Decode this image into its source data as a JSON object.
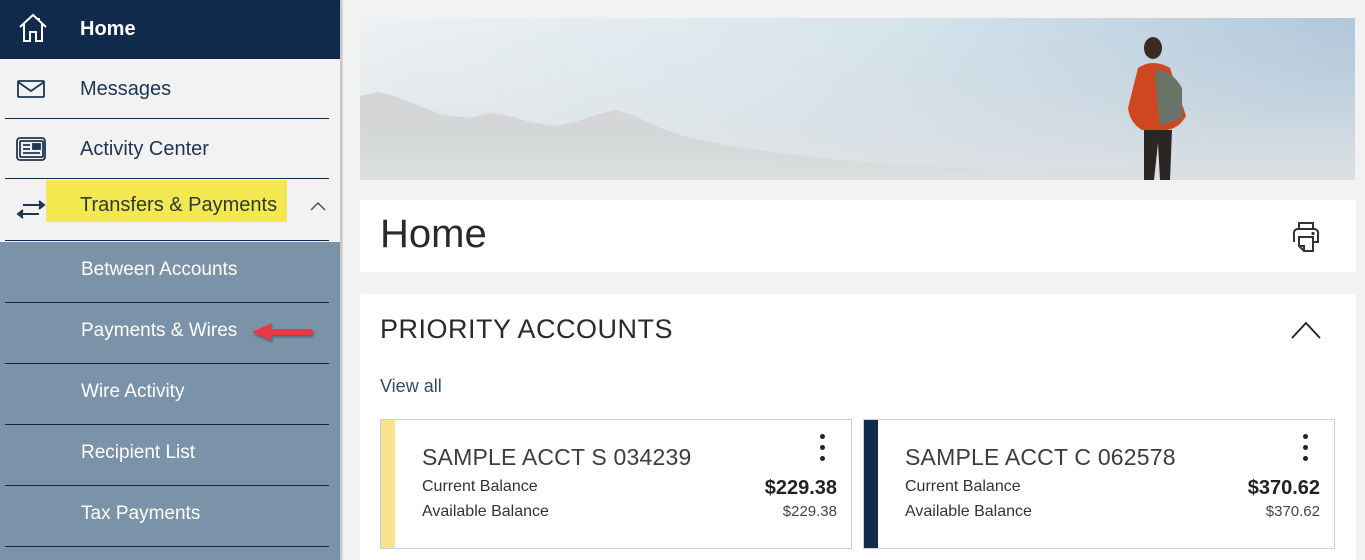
{
  "sidebar": {
    "home": {
      "label": "Home",
      "icon": "home-icon"
    },
    "items": [
      {
        "label": "Messages",
        "icon": "envelope-icon"
      },
      {
        "label": "Activity Center",
        "icon": "activity-center-icon"
      },
      {
        "label": "Transfers & Payments",
        "icon": "transfer-arrows-icon",
        "expanded": true,
        "highlighted": true
      }
    ],
    "submenu": [
      {
        "label": "Between Accounts"
      },
      {
        "label": "Payments & Wires",
        "annotated": true
      },
      {
        "label": "Wire Activity"
      },
      {
        "label": "Recipient List"
      },
      {
        "label": "Tax Payments"
      }
    ]
  },
  "banner": {
    "alt": "Hiker overlooking mountains"
  },
  "main": {
    "page_title": "Home",
    "print_icon": "printer-icon",
    "priority_accounts": {
      "title": "PRIORITY ACCOUNTS",
      "view_all": "View all",
      "accounts": [
        {
          "name": "SAMPLE ACCT S 034239",
          "current_label": "Current Balance",
          "current_value": "$229.38",
          "available_label": "Available Balance",
          "available_value": "$229.38",
          "stripe_color": "#fae38f"
        },
        {
          "name": "SAMPLE ACCT C 062578",
          "current_label": "Current Balance",
          "current_value": "$370.62",
          "available_label": "Available Balance",
          "available_value": "$370.62",
          "stripe_color": "#0f2a4a"
        }
      ]
    }
  },
  "colors": {
    "nav_dark": "#0f2a4a",
    "submenu_bg": "#7b93a8",
    "highlight": "#f3e84f",
    "annotation_arrow": "#e8393f"
  }
}
